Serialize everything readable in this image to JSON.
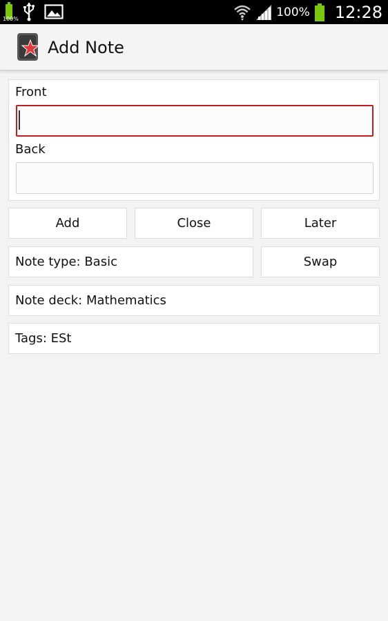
{
  "status_bar": {
    "small_battery_pct": "100%",
    "battery_pct": "100%",
    "clock": "12:28",
    "icons": [
      "battery-icon",
      "usb-icon",
      "image-icon",
      "wifi-icon",
      "signal-icon",
      "battery-icon"
    ]
  },
  "action_bar": {
    "title": "Add Note",
    "app_icon": "anki-star-icon"
  },
  "fields": {
    "front": {
      "label": "Front",
      "value": ""
    },
    "back": {
      "label": "Back",
      "value": ""
    }
  },
  "buttons": {
    "add": "Add",
    "close": "Close",
    "later": "Later",
    "swap": "Swap"
  },
  "note_type": "Note type: Basic",
  "note_deck": "Note deck: Mathematics",
  "tags": "Tags: ESt",
  "colors": {
    "focus_border": "#c21d1d",
    "battery_green": "#7ac70f",
    "background": "#f3f3f3"
  }
}
